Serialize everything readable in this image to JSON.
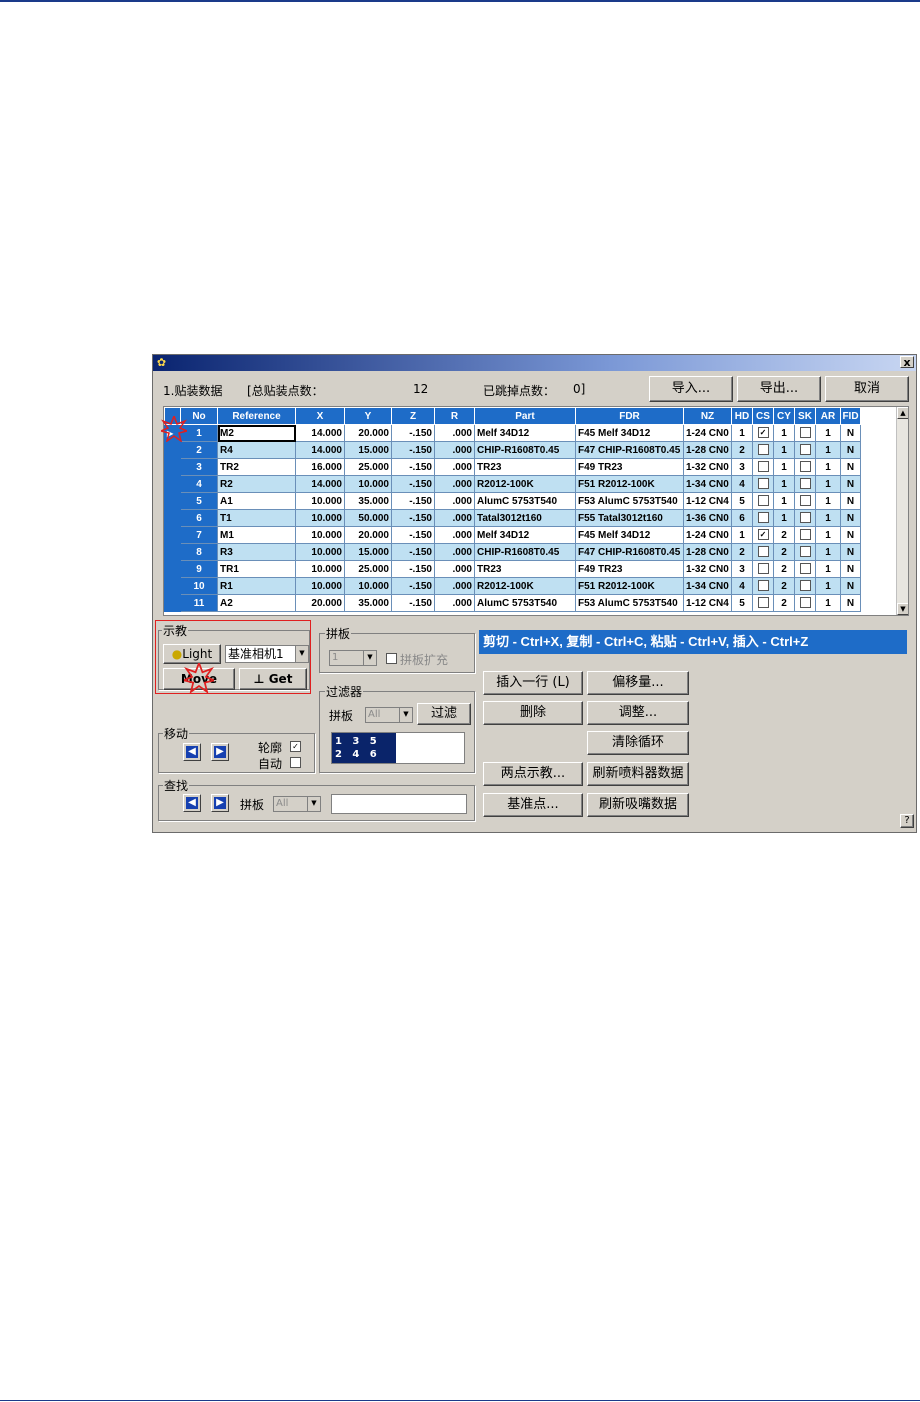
{
  "window": {
    "title_icon": "app-icon",
    "close_label": "x",
    "section_title": "1.贴装数据",
    "total_label": "[总贴装点数：",
    "total_value": "12",
    "skipped_label": "已跳掉点数：",
    "skipped_value": "0]",
    "import_label": "导入...",
    "export_label": "导出...",
    "cancel_label": "取消"
  },
  "table": {
    "columns": [
      "No",
      "Reference",
      "X",
      "Y",
      "Z",
      "R",
      "Part",
      "FDR",
      "NZ",
      "HD",
      "CS",
      "CY",
      "SK",
      "AR",
      "FID"
    ],
    "rows": [
      {
        "no": "1",
        "ref": "M2",
        "x": "14.000",
        "y": "20.000",
        "z": "-.150",
        "r": ".000",
        "part": "Melf 34D12",
        "fdr": "F45 Melf 34D12",
        "nz": "1-24 CN0",
        "hd": "1",
        "cs": true,
        "cy": "1",
        "sk": false,
        "ar": "1",
        "fid": "N"
      },
      {
        "no": "2",
        "ref": "R4",
        "x": "14.000",
        "y": "15.000",
        "z": "-.150",
        "r": ".000",
        "part": "CHIP-R1608T0.45",
        "fdr": "F47 CHIP-R1608T0.45",
        "nz": "1-28 CN0",
        "hd": "2",
        "cs": false,
        "cy": "1",
        "sk": false,
        "ar": "1",
        "fid": "N"
      },
      {
        "no": "3",
        "ref": "TR2",
        "x": "16.000",
        "y": "25.000",
        "z": "-.150",
        "r": ".000",
        "part": "TR23",
        "fdr": "F49 TR23",
        "nz": "1-32 CN0",
        "hd": "3",
        "cs": false,
        "cy": "1",
        "sk": false,
        "ar": "1",
        "fid": "N"
      },
      {
        "no": "4",
        "ref": "R2",
        "x": "14.000",
        "y": "10.000",
        "z": "-.150",
        "r": ".000",
        "part": "R2012-100K",
        "fdr": "F51 R2012-100K",
        "nz": "1-34 CN0",
        "hd": "4",
        "cs": false,
        "cy": "1",
        "sk": false,
        "ar": "1",
        "fid": "N"
      },
      {
        "no": "5",
        "ref": "A1",
        "x": "10.000",
        "y": "35.000",
        "z": "-.150",
        "r": ".000",
        "part": "AlumC 5753T540",
        "fdr": "F53 AlumC 5753T540",
        "nz": "1-12 CN4",
        "hd": "5",
        "cs": false,
        "cy": "1",
        "sk": false,
        "ar": "1",
        "fid": "N"
      },
      {
        "no": "6",
        "ref": "T1",
        "x": "10.000",
        "y": "50.000",
        "z": "-.150",
        "r": ".000",
        "part": "Tatal3012t160",
        "fdr": "F55 Tatal3012t160",
        "nz": "1-36 CN0",
        "hd": "6",
        "cs": false,
        "cy": "1",
        "sk": false,
        "ar": "1",
        "fid": "N"
      },
      {
        "no": "7",
        "ref": "M1",
        "x": "10.000",
        "y": "20.000",
        "z": "-.150",
        "r": ".000",
        "part": "Melf 34D12",
        "fdr": "F45 Melf 34D12",
        "nz": "1-24 CN0",
        "hd": "1",
        "cs": true,
        "cy": "2",
        "sk": false,
        "ar": "1",
        "fid": "N"
      },
      {
        "no": "8",
        "ref": "R3",
        "x": "10.000",
        "y": "15.000",
        "z": "-.150",
        "r": ".000",
        "part": "CHIP-R1608T0.45",
        "fdr": "F47 CHIP-R1608T0.45",
        "nz": "1-28 CN0",
        "hd": "2",
        "cs": false,
        "cy": "2",
        "sk": false,
        "ar": "1",
        "fid": "N"
      },
      {
        "no": "9",
        "ref": "TR1",
        "x": "10.000",
        "y": "25.000",
        "z": "-.150",
        "r": ".000",
        "part": "TR23",
        "fdr": "F49 TR23",
        "nz": "1-32 CN0",
        "hd": "3",
        "cs": false,
        "cy": "2",
        "sk": false,
        "ar": "1",
        "fid": "N"
      },
      {
        "no": "10",
        "ref": "R1",
        "x": "10.000",
        "y": "10.000",
        "z": "-.150",
        "r": ".000",
        "part": "R2012-100K",
        "fdr": "F51 R2012-100K",
        "nz": "1-34 CN0",
        "hd": "4",
        "cs": false,
        "cy": "2",
        "sk": false,
        "ar": "1",
        "fid": "N"
      },
      {
        "no": "11",
        "ref": "A2",
        "x": "20.000",
        "y": "35.000",
        "z": "-.150",
        "r": ".000",
        "part": "AlumC 5753T540",
        "fdr": "F53 AlumC 5753T540",
        "nz": "1-12 CN4",
        "hd": "5",
        "cs": false,
        "cy": "2",
        "sk": false,
        "ar": "1",
        "fid": "N"
      }
    ]
  },
  "teach": {
    "group_label": "示教",
    "light_label": "Light",
    "camera_value": "基准相机1",
    "move_label": "Move",
    "get_label": "Get"
  },
  "panel": {
    "group_label": "拼板",
    "panel_value": "1",
    "expand_label": "拼板扩充"
  },
  "filter": {
    "group_label": "过滤器",
    "panel_label": "拼板",
    "panel_value": "All",
    "filter_button": "过滤",
    "list_line1": "1   3   5",
    "list_line2": "2   4   6"
  },
  "move": {
    "group_label": "移动",
    "outline_label": "轮廓",
    "outline_checked": true,
    "auto_label": "自动",
    "auto_checked": false
  },
  "find": {
    "group_label": "查找",
    "panel_label": "拼板",
    "panel_value": "All",
    "search_value": ""
  },
  "hint": "剪切 - Ctrl+X, 复制 - Ctrl+C,  粘贴 - Ctrl+V,  插入 - Ctrl+Z",
  "actions": {
    "insert_row": "插入一行 (L)",
    "offset": "偏移量...",
    "delete": "删除",
    "adjust": "调整...",
    "clear_loop": "清除循环",
    "two_point": "两点示教...",
    "refresh_feeder": "刷新喷料器数据",
    "fiducial": "基准点...",
    "refresh_nozzle": "刷新吸嘴数据",
    "help": "?"
  },
  "colors": {
    "accent": "#1e6cc8",
    "row_alt": "#bfe0f2",
    "highlight": "#e02020"
  }
}
